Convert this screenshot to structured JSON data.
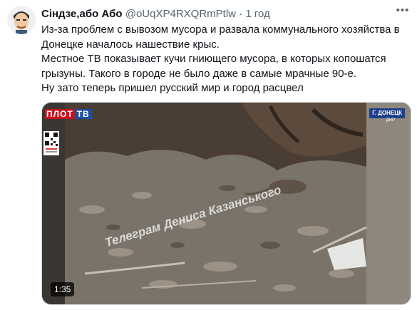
{
  "tweet": {
    "author_name": "Сіндзе,або Або",
    "author_handle": "@oUqXP4RXQRmPtlw",
    "separator": "·",
    "time": "1 год",
    "text_lines": [
      "Из-за проблем с вывозом мусора и развала коммунального хозяйства в Донецке началось нашествие крыс.",
      "Местное ТВ показывает кучи гниющего мусора, в которых копошатся грызуны. Такого в городе не было даже в самые мрачные 90-е.",
      "Ну зато теперь пришел русский мир и город расцвел"
    ]
  },
  "video": {
    "channel_part1": "ПЛОТ",
    "channel_part2": "ТВ",
    "city_badge": "Г. ДОНЕЦК",
    "region": "ДНР",
    "watermark": "Телеграм Дениса Казанського",
    "duration": "1:35"
  },
  "colors": {
    "text": "#0f1419",
    "secondary_text": "#536471",
    "channel_red": "#c9121b",
    "channel_blue": "#1a4fa0"
  },
  "icons": {
    "more": "more-horizontal-icon",
    "avatar": "cartoon-avatar"
  }
}
